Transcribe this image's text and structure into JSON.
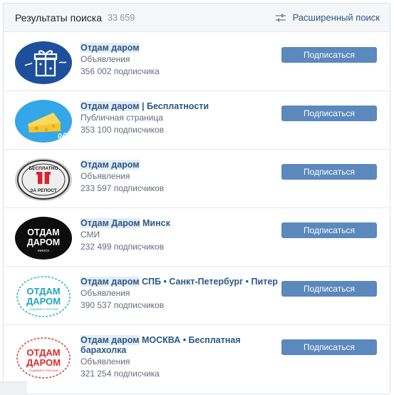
{
  "header": {
    "title": "Результаты поиска",
    "count": "33 659",
    "advanced_search": "Расширенный поиск"
  },
  "colors": {
    "link": "#2a5885",
    "button": "#5b88bd",
    "muted": "#626d7a"
  },
  "results": [
    {
      "name_highlight": "Отдам даром",
      "name_rest": "",
      "type": "Объявления",
      "subscribers": "356 002 подписчика",
      "button": "Подписаться",
      "avatar_icon": "gift-box-icon"
    },
    {
      "name_highlight": "Отдам даром",
      "name_rest": " | Бесплатности",
      "type": "Публичная страница",
      "subscribers": "353 100 подписчиков",
      "button": "Подписаться",
      "avatar_icon": "cheese-icon",
      "avatar_text": "0₽"
    },
    {
      "name_highlight": "Отдам даром",
      "name_rest": "",
      "type": "Объявления",
      "subscribers": "233 597 подписчиков",
      "button": "Подписаться",
      "avatar_icon": "gift-stamp-icon",
      "avatar_text_top": "БЕСПЛАТНО",
      "avatar_text_bottom": "ЗА РЕПОСТ"
    },
    {
      "name_highlight": "Отдам Даром",
      "name_rest": " Минск",
      "type": "СМИ",
      "subscribers": "232 499 подписчиков",
      "button": "Подписаться",
      "avatar_icon": "text-logo-icon",
      "avatar_line1": "ОТДАМ",
      "avatar_line2": "ДАРОМ",
      "avatar_line3": "МИНСК"
    },
    {
      "name_highlight": "Отдам даром",
      "name_rest": " СПБ • Санкт-Петербург • Питер",
      "type": "Объявления",
      "subscribers": "390 537 подписчиков",
      "button": "Подписаться",
      "avatar_icon": "text-logo-icon",
      "avatar_line1": "ОТДАМ",
      "avatar_line2": "ДАРОМ",
      "avatar_line3": "ОТДАВАЙ И ПОЛУЧАЙ"
    },
    {
      "name_highlight": "Отдам даром",
      "name_rest": " МОСКВА • Бесплатная барахолка",
      "type": "Объявления",
      "subscribers": "321 254 подписчика",
      "button": "Подписаться",
      "avatar_icon": "text-logo-icon",
      "avatar_line1": "ОТДАМ",
      "avatar_line2": "ДАРОМ",
      "avatar_line3": "ОТДАВАЙ И ПОЛУЧАЙ"
    }
  ]
}
